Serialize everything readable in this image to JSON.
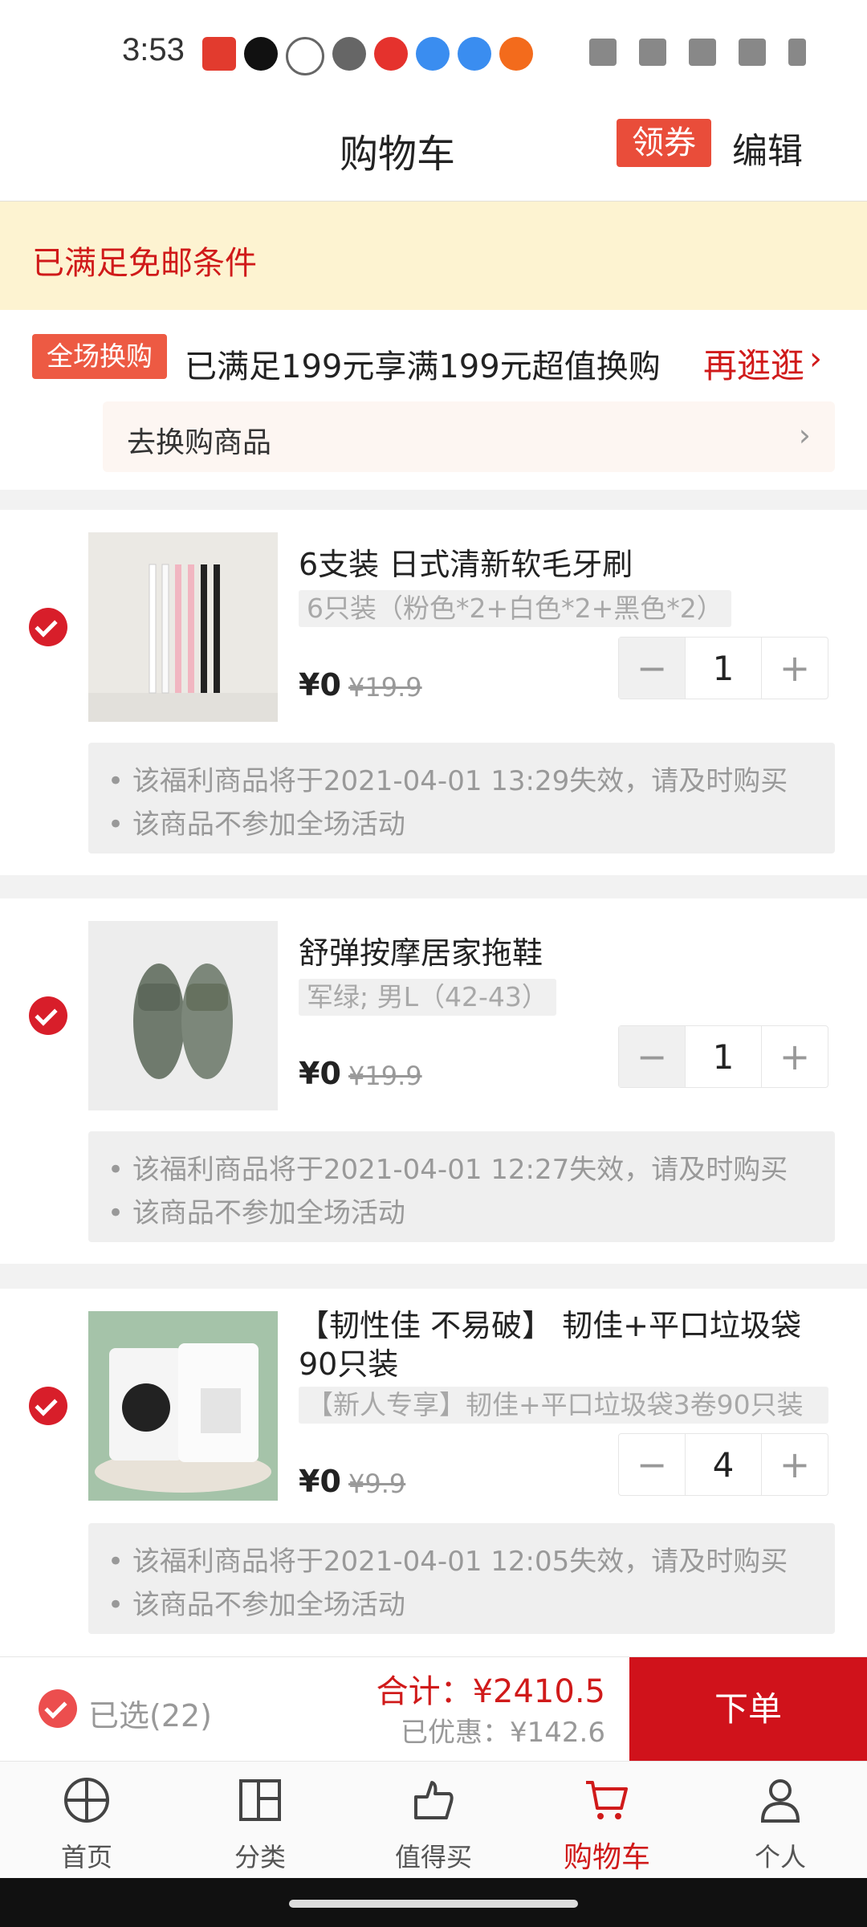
{
  "status_bar": {
    "time": "3:53"
  },
  "header": {
    "title": "购物车",
    "coupon": "领券",
    "edit": "编辑"
  },
  "banner": {
    "text": "已满足免邮条件"
  },
  "promo": {
    "tag": "全场换购",
    "text": "已满足199元享满199元超值换购",
    "more": "再逛逛",
    "swap_label": "去换购商品"
  },
  "items": [
    {
      "title": "6支装 日式清新软毛牙刷",
      "variant": "6只装（粉色*2+白色*2+黑色*2）",
      "price": "¥0",
      "original_price": "¥19.9",
      "quantity": "1",
      "minus": "−",
      "plus": "+",
      "notice": [
        "• 该福利商品将于2021-04-01 13:29失效，请及时购买",
        "• 该商品不参加全场活动"
      ]
    },
    {
      "title": "舒弹按摩居家拖鞋",
      "variant": "军绿; 男L（42-43）",
      "price": "¥0",
      "original_price": "¥19.9",
      "quantity": "1",
      "minus": "−",
      "plus": "+",
      "notice": [
        "• 该福利商品将于2021-04-01 12:27失效，请及时购买",
        "• 该商品不参加全场活动"
      ]
    },
    {
      "title": "【韧性佳 不易破】 韧佳+平口垃圾袋90只装",
      "variant": "【新人专享】韧佳+平口垃圾袋3卷90只装",
      "price": "¥0",
      "original_price": "¥9.9",
      "quantity": "4",
      "minus": "−",
      "plus": "+",
      "notice": [
        "• 该福利商品将于2021-04-01 12:05失效，请及时购买",
        "• 该商品不参加全场活动"
      ]
    }
  ],
  "checkout": {
    "selected": "已选(22)",
    "total": "合计：¥2410.5",
    "discount": "已优惠：¥142.6",
    "order_button": "下单"
  },
  "tabs": [
    {
      "label": "首页",
      "icon": "home-icon"
    },
    {
      "label": "分类",
      "icon": "category-icon"
    },
    {
      "label": "值得买",
      "icon": "deals-icon"
    },
    {
      "label": "购物车",
      "icon": "cart-icon",
      "active": true
    },
    {
      "label": "个人",
      "icon": "profile-icon"
    }
  ],
  "colors": {
    "accent": "#d01a1a",
    "banner_bg": "#fdf3d1"
  }
}
